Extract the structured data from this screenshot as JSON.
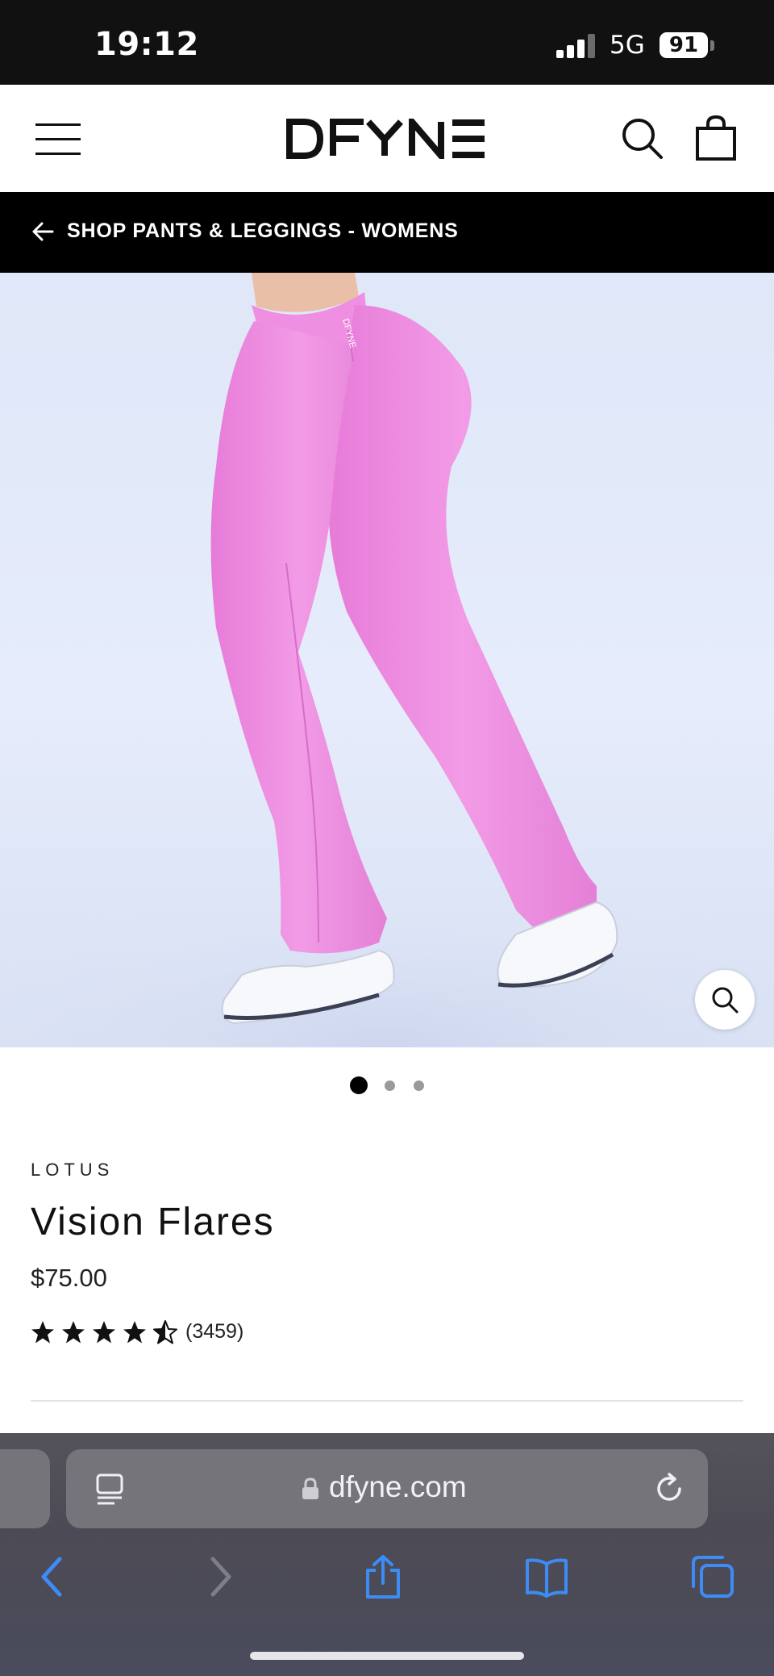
{
  "status_bar": {
    "time": "19:12",
    "network": "5G",
    "battery": "91"
  },
  "header": {
    "logo": "DFYNE",
    "icons": [
      "menu-icon",
      "search-icon",
      "shopping-bag-icon"
    ]
  },
  "breadcrumb": {
    "label": "SHOP PANTS & LEGGINGS - WOMENS",
    "icon": "arrow-left-icon"
  },
  "gallery": {
    "image_count": 3,
    "active_index": 0,
    "zoom_icon": "zoom-icon"
  },
  "product": {
    "vendor": "LOTUS",
    "title": "Vision Flares",
    "price": "$75.00",
    "rating": {
      "value": 4.5,
      "max": 5,
      "count_label": "(3459)"
    }
  },
  "browser": {
    "url": "dfyne.com",
    "accent_color": "#3d8cf5",
    "icons": [
      "reader-icon",
      "lock-icon",
      "reload-icon",
      "back-icon",
      "forward-icon",
      "share-icon",
      "bookmarks-icon",
      "tabs-icon"
    ]
  },
  "colors": {
    "header_bar": "#000000",
    "leggings": "#ee8fe0",
    "image_background": "#e2e9fa"
  }
}
